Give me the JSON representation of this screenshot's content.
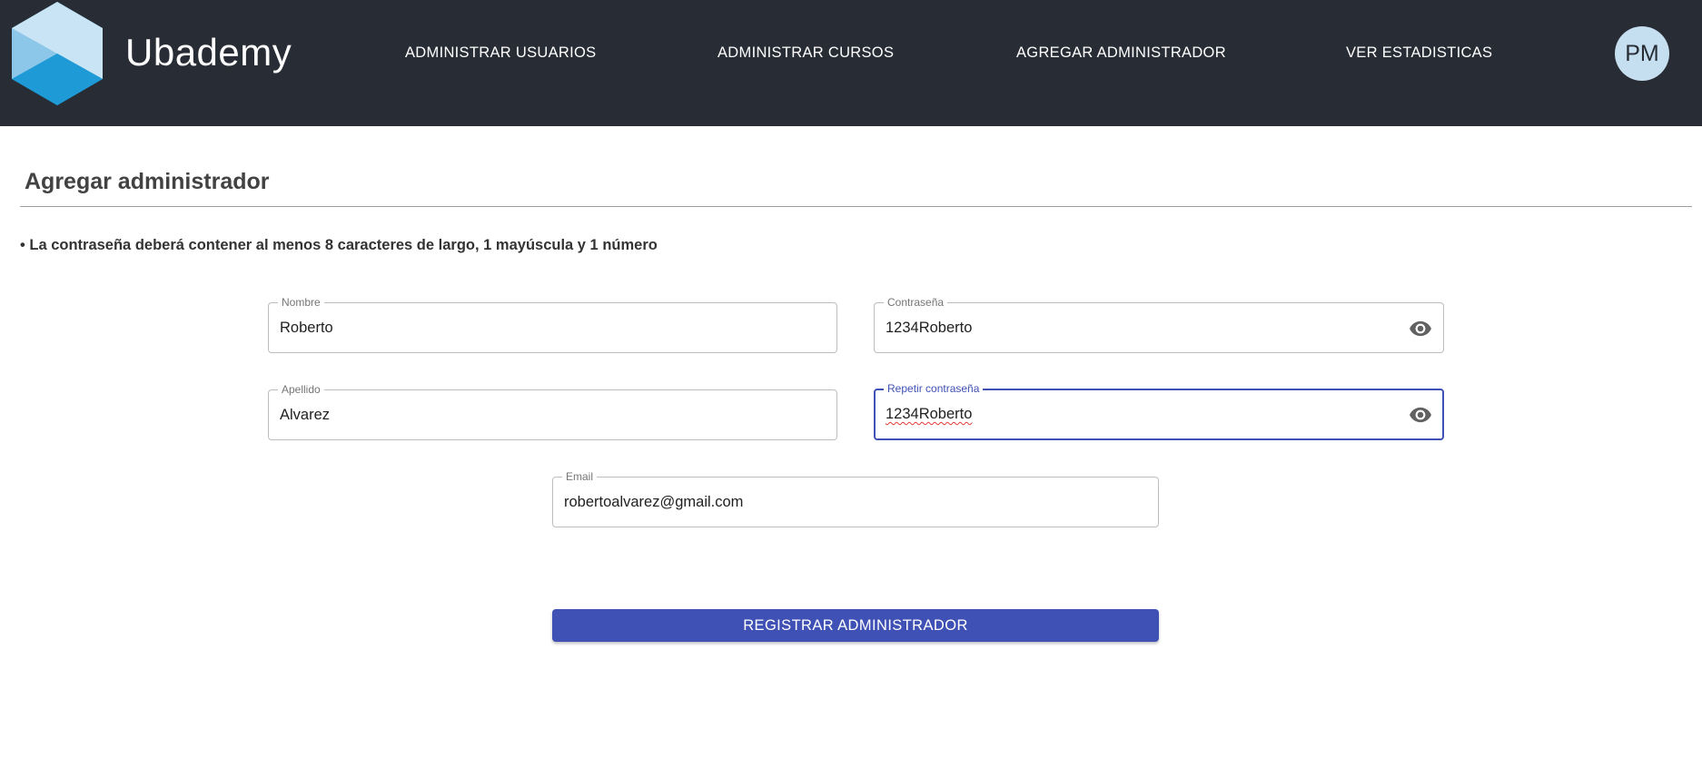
{
  "header": {
    "brand": "Ubademy",
    "nav": [
      {
        "label": "ADMINISTRAR USUARIOS"
      },
      {
        "label": "ADMINISTRAR CURSOS"
      },
      {
        "label": "AGREGAR ADMINISTRADOR"
      },
      {
        "label": "VER ESTADISTICAS"
      }
    ],
    "avatar_initials": "PM",
    "colors": {
      "bar": "#282c34",
      "avatar_bg": "#c6dff0"
    }
  },
  "page": {
    "title": "Agregar administrador",
    "hint": "• La contraseña deberá contener al menos 8 caracteres de largo, 1 mayúscula y 1 número"
  },
  "form": {
    "nombre": {
      "label": "Nombre",
      "value": "Roberto"
    },
    "apellido": {
      "label": "Apellido",
      "value": "Alvarez"
    },
    "contrasena": {
      "label": "Contraseña",
      "value": "1234Roberto",
      "icon": "eye-icon"
    },
    "repetir": {
      "label": "Repetir contraseña",
      "value": "1234Roberto",
      "icon": "eye-icon"
    },
    "email": {
      "label": "Email",
      "value": "robertoalvarez@gmail.com"
    },
    "submit_label": "REGISTRAR ADMINISTRADOR",
    "colors": {
      "primary": "#3f51b5"
    }
  }
}
